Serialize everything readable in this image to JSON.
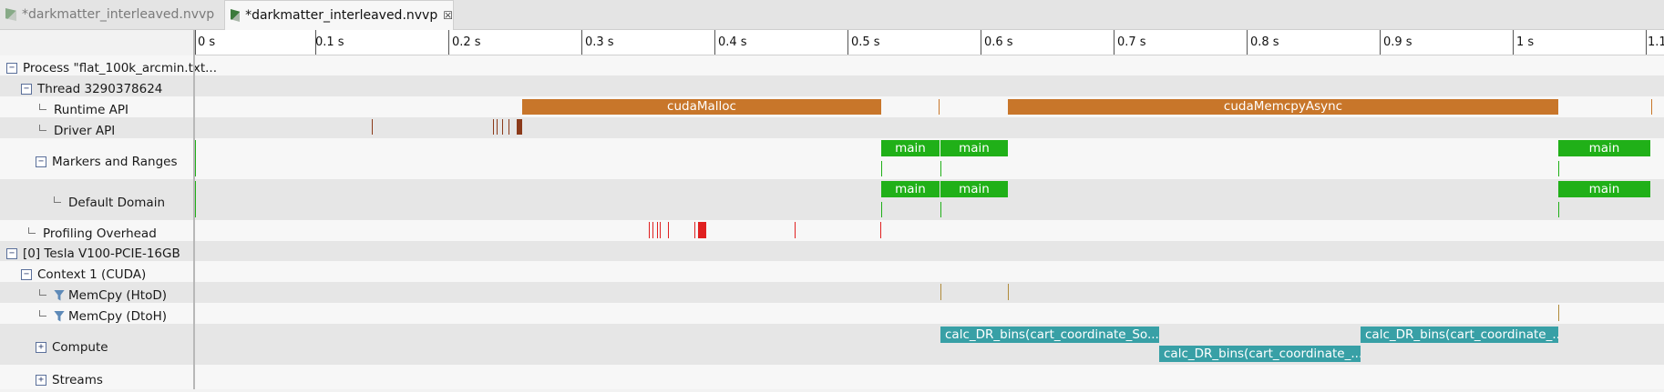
{
  "tabs": [
    {
      "label": "*darkmatter_interleaved.nvvp",
      "active": false
    },
    {
      "label": "*darkmatter_interleaved.nvvp",
      "active": true,
      "close_icon": "close-icon"
    }
  ],
  "ruler": {
    "ticks": [
      "0 s",
      "0.1 s",
      "0.2 s",
      "0.3 s",
      "0.4 s",
      "0.5 s",
      "0.6 s",
      "0.7 s",
      "0.8 s",
      "0.9 s",
      "1 s",
      "1.1"
    ]
  },
  "tree": {
    "process": "Process \"flat_100k_arcmin.txt...",
    "thread": "Thread 3290378624",
    "runtime_api": "Runtime API",
    "driver_api": "Driver API",
    "markers_ranges": "Markers and Ranges",
    "default_domain": "Default Domain",
    "profiling_overhead": "Profiling Overhead",
    "device": "[0] Tesla V100-PCIE-16GB",
    "context": "Context 1 (CUDA)",
    "memcpy_htod": "MemCpy (HtoD)",
    "memcpy_dtoh": "MemCpy (DtoH)",
    "compute": "Compute",
    "streams": "Streams"
  },
  "timeline": {
    "runtime_bars": [
      "cudaMalloc",
      "cudaMemcpyAsync"
    ],
    "range_label": "main",
    "kernel_labels": [
      "calc_DR_bins(cart_coordinate_So...",
      "calc_DR_bins(cart_coordinate_...",
      "calc_DR_bins(cart_coordinate_..."
    ]
  },
  "colors": {
    "runtime": "#c8762a",
    "driver": "#8b3a1a",
    "ranges": "#20b018",
    "overhead": "#e02020",
    "kernel": "#38a0a6"
  }
}
